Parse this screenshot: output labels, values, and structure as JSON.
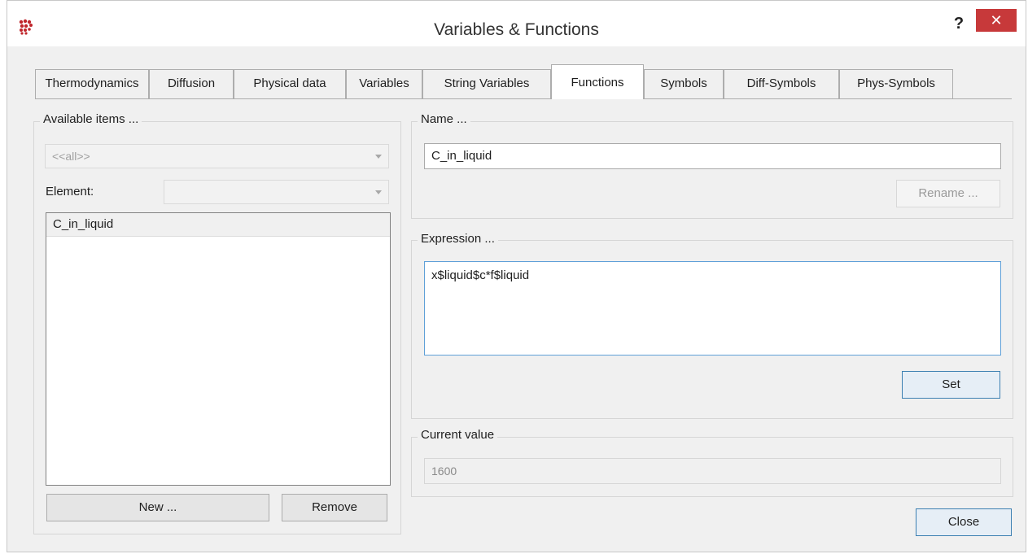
{
  "window": {
    "title": "Variables & Functions",
    "help_label": "?",
    "close_label": "✕",
    "icon": "app-logo-icon",
    "accent_close": "#c7393a"
  },
  "tabs": [
    {
      "label": "Thermodynamics"
    },
    {
      "label": "Diffusion"
    },
    {
      "label": "Physical data"
    },
    {
      "label": "Variables"
    },
    {
      "label": "String Variables"
    },
    {
      "label": "Functions",
      "active": true
    },
    {
      "label": "Symbols"
    },
    {
      "label": "Diff-Symbols"
    },
    {
      "label": "Phys-Symbols"
    }
  ],
  "available": {
    "group_label": "Available items ...",
    "filter_value": "<<all>>",
    "element_label": "Element:",
    "element_value": "",
    "items": [
      "C_in_liquid"
    ],
    "new_label": "New ...",
    "remove_label": "Remove"
  },
  "name": {
    "group_label": "Name ...",
    "value": "C_in_liquid",
    "rename_label": "Rename ..."
  },
  "expression": {
    "group_label": "Expression ...",
    "value": "x$liquid$c*f$liquid",
    "set_label": "Set"
  },
  "current_value": {
    "group_label": "Current value",
    "value": "1600"
  },
  "footer": {
    "close_label": "Close"
  }
}
